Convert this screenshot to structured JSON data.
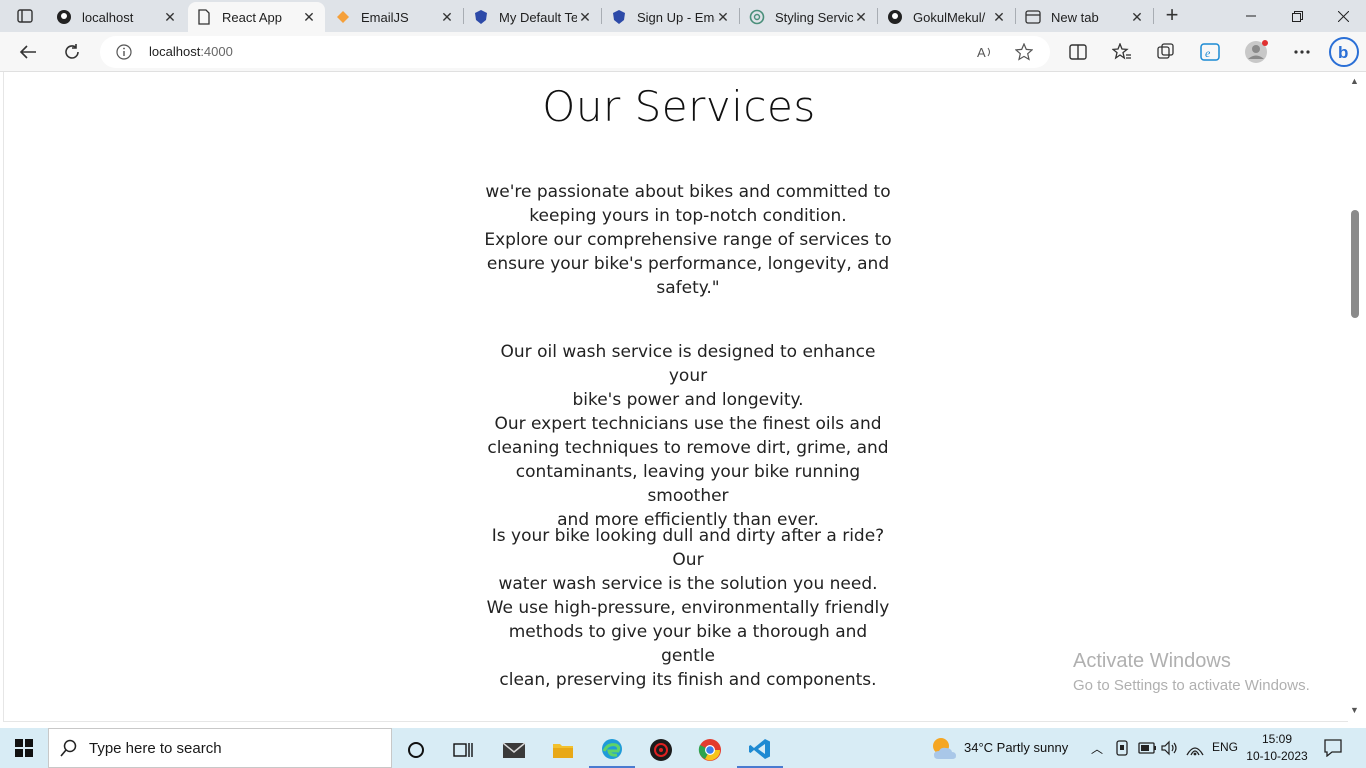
{
  "tabs": [
    {
      "title": "localhost",
      "icon": "github-icon",
      "active": false
    },
    {
      "title": "React App",
      "icon": "page-icon",
      "active": true
    },
    {
      "title": "EmailJS",
      "icon": "emailjs-icon",
      "active": false
    },
    {
      "title": "My Default Te",
      "icon": "shield-icon",
      "active": false
    },
    {
      "title": "Sign Up - Ema",
      "icon": "shield-icon",
      "active": false
    },
    {
      "title": "Styling Servic",
      "icon": "openai-icon",
      "active": false
    },
    {
      "title": "GokulMekul/",
      "icon": "github-icon",
      "active": false
    },
    {
      "title": "New tab",
      "icon": "newtab-icon",
      "active": false
    }
  ],
  "address": {
    "host": "localhost",
    "port": ":4000"
  },
  "page": {
    "heading": "Our Services",
    "paragraphs": [
      [
        "we're passionate about bikes and committed to",
        "keeping yours in top-notch condition.",
        "Explore our comprehensive range of services to",
        "ensure your bike's performance, longevity, and",
        "safety.\""
      ],
      [
        "Our oil wash service is designed to enhance your",
        "bike's power and longevity.",
        "Our expert technicians use the finest oils and",
        "cleaning techniques to remove dirt, grime, and",
        "contaminants, leaving your bike running smoother",
        "and more efficiently than ever."
      ],
      [
        "Is your bike looking dull and dirty after a ride? Our",
        "water wash service is the solution you need.",
        "We use high-pressure, environmentally friendly",
        "methods to give your bike a thorough and gentle",
        "clean, preserving its finish and components."
      ]
    ]
  },
  "watermark": {
    "line1": "Activate Windows",
    "line2": "Go to Settings to activate Windows."
  },
  "taskbar": {
    "search_placeholder": "Type here to search",
    "weather": "34°C  Partly sunny",
    "lang": "ENG",
    "time": "15:09",
    "date": "10-10-2023"
  },
  "colors": {
    "accent": "#0078d4",
    "taskbar": "#d8ecf5",
    "tabbar": "#dfe3e8"
  }
}
